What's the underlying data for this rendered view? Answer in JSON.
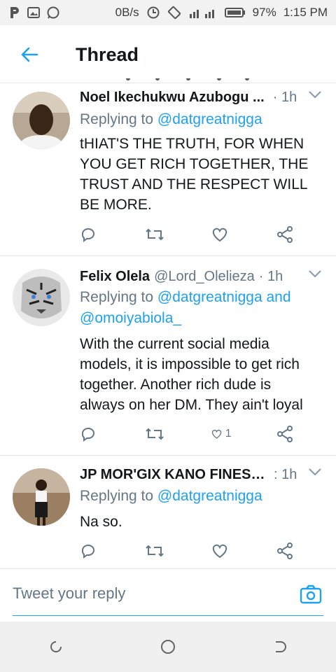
{
  "status": {
    "network_speed": "0B/s",
    "battery": "97%",
    "time": "1:15 PM"
  },
  "header": {
    "title": "Thread"
  },
  "tweets": [
    {
      "name": "Noel Ikechukwu Azubogu ...",
      "handle": "",
      "time": "· 1h",
      "replying_prefix": "Replying to ",
      "replying_to": "@datgreatnigga",
      "replying_extra": "",
      "text": "tHIAT'S THE TRUTH, FOR WHEN YOU GET RICH TOGETHER, THE TRUST AND THE RESPECT WILL BE MORE.",
      "likes": ""
    },
    {
      "name": "Felix Olela",
      "handle": "@Lord_Olelieza",
      "time": "· 1h",
      "replying_prefix": "Replying to ",
      "replying_to": "@datgreatnigga and @omoiyabiola_",
      "replying_extra": "",
      "text": "With the current social media models, it is impossible to get rich together. Another rich dude is always on her DM. They ain't loyal",
      "likes": "1"
    },
    {
      "name": "JP MOR'GIX KANO FINEST ...",
      "handle": "",
      "time": ": 1h",
      "replying_prefix": "Replying to ",
      "replying_to": "@datgreatnigga",
      "replying_extra": "",
      "text": "Na so.",
      "likes": ""
    }
  ],
  "compose": {
    "placeholder": "Tweet your reply"
  },
  "colors": {
    "accent": "#1da1f2",
    "secondary_text": "#657786",
    "divider": "#e1e8ed"
  }
}
